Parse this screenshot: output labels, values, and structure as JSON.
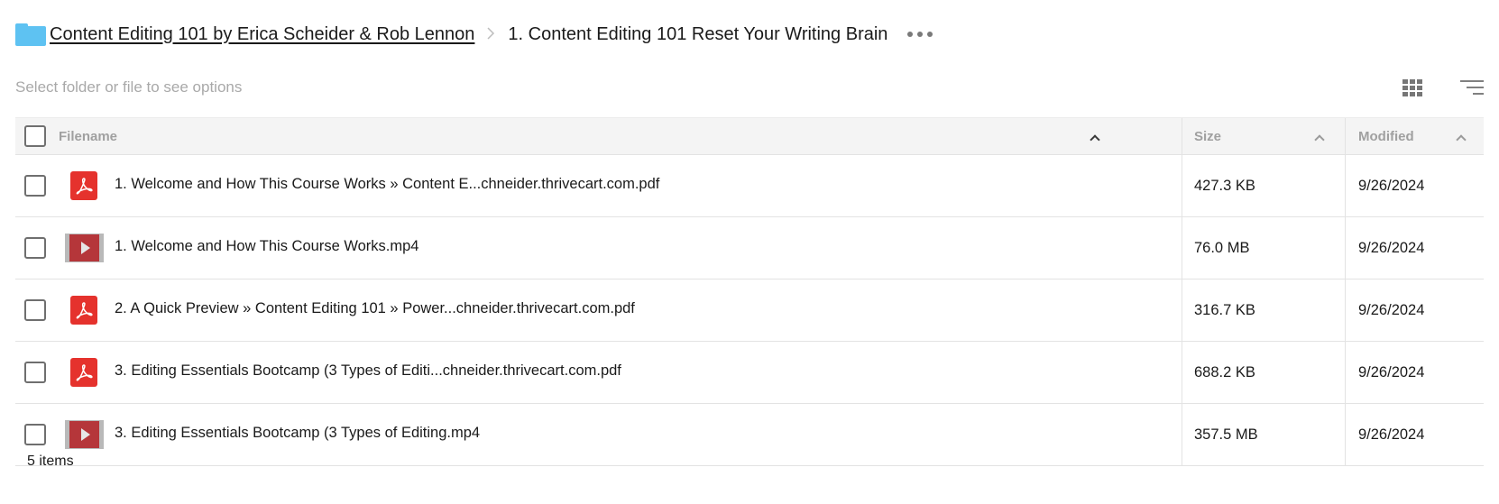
{
  "breadcrumb": {
    "parent": "Content Editing 101 by Erica Scheider & Rob Lennon",
    "separator": ">",
    "current": "1. Content Editing 101 Reset Your Writing Brain",
    "icons": {
      "folder": "folder-icon",
      "more": "more-options-icon"
    }
  },
  "toolbar": {
    "hint": "Select folder or file to see options",
    "icons": {
      "view": "grid-view-icon",
      "sort": "sort-icon"
    }
  },
  "table": {
    "columns": {
      "filename": "Filename",
      "size": "Size",
      "modified": "Modified"
    },
    "rows": [
      {
        "name": "1. Welcome and How This Course Works » Content E...chneider.thrivecart.com.pdf",
        "size": "427.3 KB",
        "modified": "9/26/2024",
        "type": "pdf"
      },
      {
        "name": "1. Welcome and How This Course Works.mp4",
        "size": "76.0 MB",
        "modified": "9/26/2024",
        "type": "video"
      },
      {
        "name": "2. A Quick Preview » Content Editing 101 » Power...chneider.thrivecart.com.pdf",
        "size": "316.7 KB",
        "modified": "9/26/2024",
        "type": "pdf"
      },
      {
        "name": "3. Editing Essentials Bootcamp (3 Types of Editi...chneider.thrivecart.com.pdf",
        "size": "688.2 KB",
        "modified": "9/26/2024",
        "type": "pdf"
      },
      {
        "name": "3. Editing Essentials Bootcamp (3 Types of Editing.mp4",
        "size": "357.5 MB",
        "modified": "9/26/2024",
        "type": "video"
      }
    ]
  },
  "footer": {
    "count": "5 items"
  },
  "colors": {
    "folder": "#5ec2f2",
    "pdf": "#e5322d",
    "video": "#b5363a"
  }
}
